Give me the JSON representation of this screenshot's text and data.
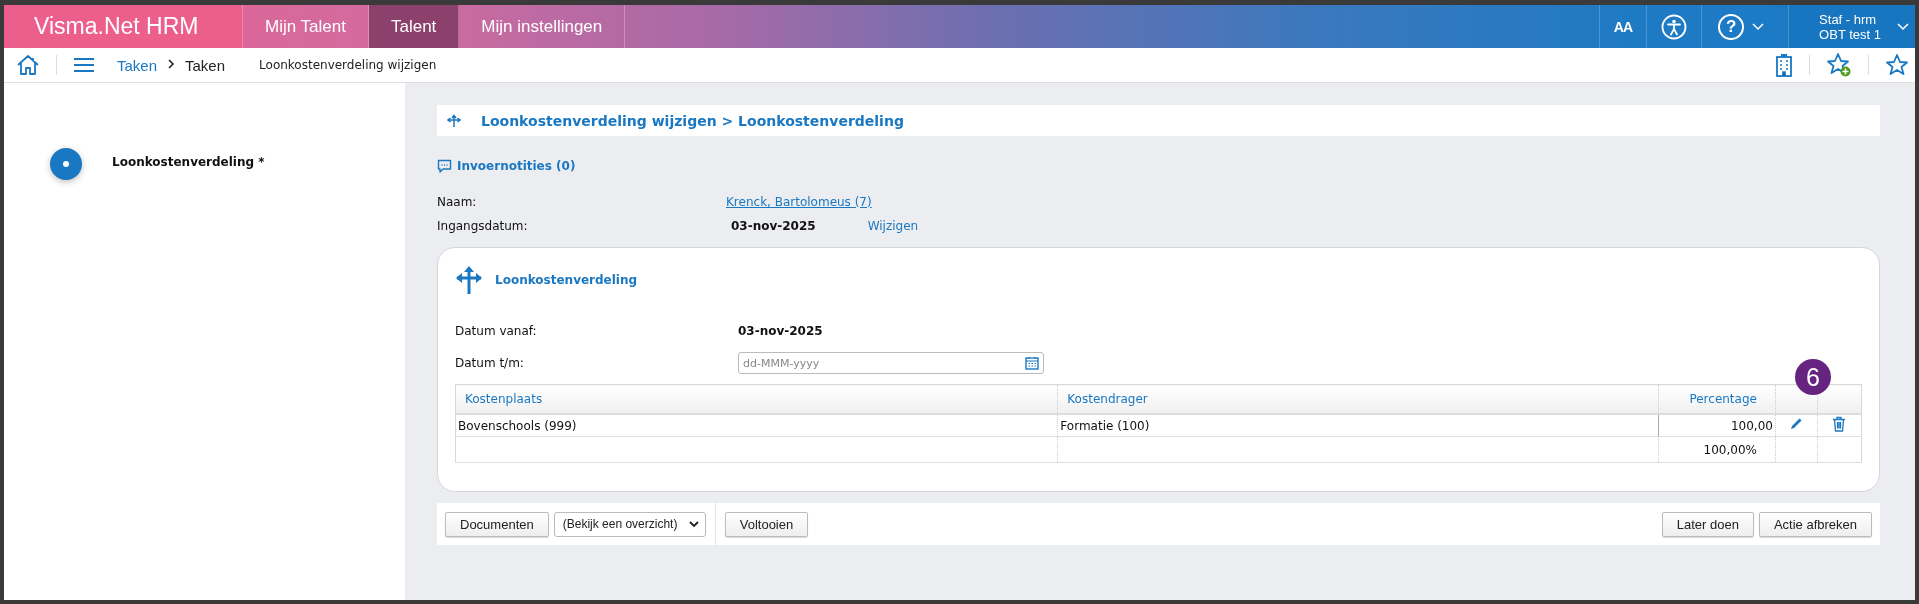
{
  "header": {
    "brand": "Visma.Net HRM",
    "tabs": [
      {
        "label": "Mijn Talent",
        "selected": false
      },
      {
        "label": "Talent",
        "selected": true
      },
      {
        "label": "Mijn instellingen",
        "selected": false
      }
    ],
    "font_size": "AA",
    "help": "?",
    "user": {
      "name": "Staf - hrm",
      "org": "OBT test 1"
    }
  },
  "toolbar": {
    "breadcrumbs": [
      "Taken",
      "Taken"
    ],
    "page": "Loonkostenverdeling wijzigen"
  },
  "steps": [
    {
      "label": "Loonkostenverdeling *",
      "selected": true
    }
  ],
  "title": "Loonkostenverdeling wijzigen > Loonkostenverdeling",
  "notes": "Invoernotities (0)",
  "fields": [
    {
      "label": "Naam:",
      "value": "Krenck, Bartolomeus (7)",
      "kind": "link"
    },
    {
      "label": "Ingangsdatum:",
      "value": "03-nov-2025",
      "kind": "bold",
      "action": "Wijzigen"
    }
  ],
  "card": {
    "title": "Loonkostenverdeling",
    "date_from": {
      "label": "Datum vanaf:",
      "value": "03-nov-2025"
    },
    "date_to": {
      "label": "Datum t/m:",
      "placeholder": "dd-MMM-yyyy"
    },
    "table": {
      "columns": [
        "Kostenplaats",
        "Kostendrager",
        "Percentage"
      ],
      "rows": [
        {
          "cells": [
            "Bovenschools (999)",
            "Formatie (100)",
            "100,00"
          ]
        }
      ],
      "total": "100,00%"
    },
    "badge": "6"
  },
  "footer": {
    "documents": "Documenten",
    "overview": "(Bekijk een overzicht)",
    "complete": "Voltooien",
    "later": "Later doen",
    "cancel": "Actie afbreken"
  }
}
